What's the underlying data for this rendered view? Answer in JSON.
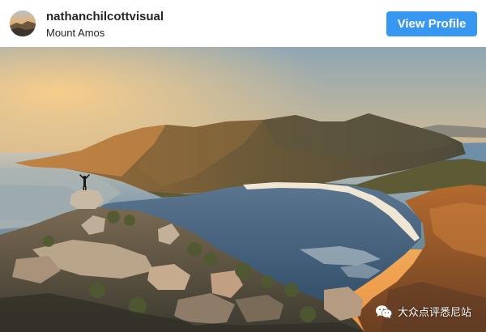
{
  "post": {
    "username": "nathanchilcottvisual",
    "location": "Mount Amos",
    "view_profile_label": "View Profile",
    "avatar_icon": "profile-avatar",
    "accent_color": "#3897f0"
  },
  "photo": {
    "subject_icon": "landscape-photo"
  },
  "watermark": {
    "icon": "wechat-icon",
    "text": "大众点评悉尼站"
  }
}
